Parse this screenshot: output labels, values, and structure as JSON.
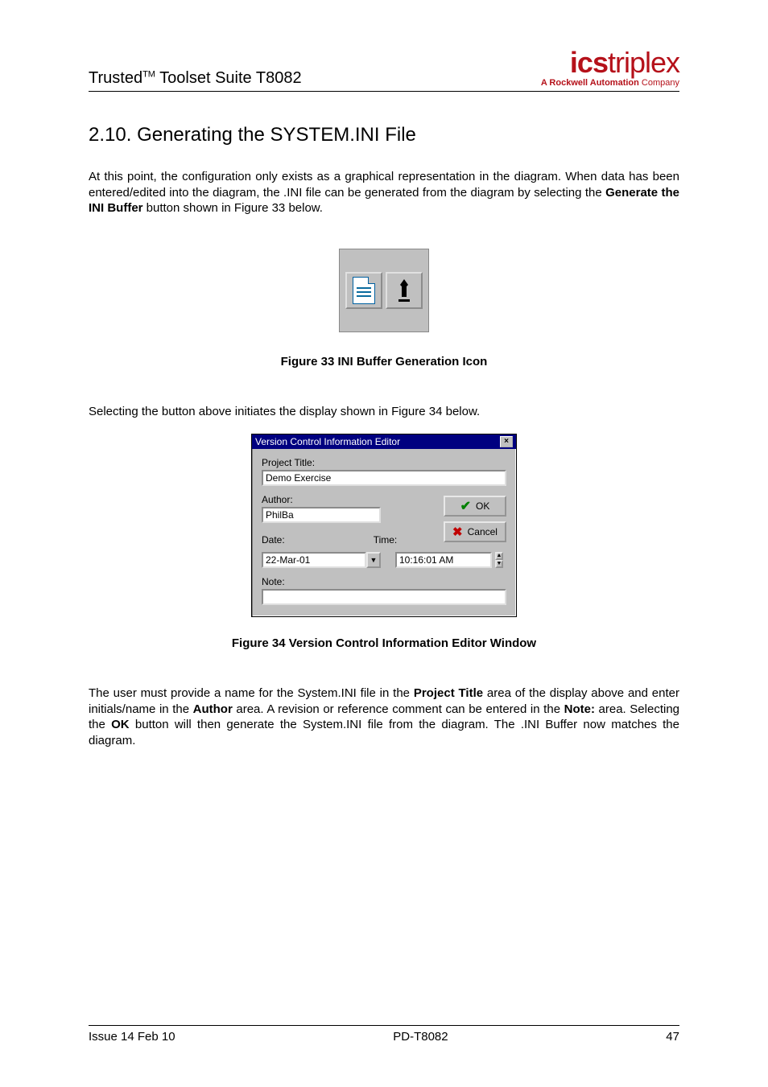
{
  "header": {
    "product_line": "Trusted",
    "tm": "TM",
    "product_suffix": " Toolset Suite T8082",
    "logo_bold": "ics",
    "logo_light": "triplex",
    "tagline_prefix": "A ",
    "tagline_bold": "Rockwell Automation",
    "tagline_suffix": " Company"
  },
  "section": {
    "number": "2.10.",
    "title": "Generating the SYSTEM.INI File"
  },
  "para1_a": "At this point, the configuration only exists as a graphical representation in the diagram. When data has been entered/edited into the diagram, the .INI file can be generated from the diagram by selecting the ",
  "para1_bold": "Generate the INI Buffer",
  "para1_b": " button shown in Figure 33 below.",
  "fig33_caption": "Figure 33 INI Buffer Generation Icon",
  "para2": "Selecting the button above initiates the display shown in Figure 34 below.",
  "dialog": {
    "title": "Version Control Information Editor",
    "labels": {
      "project_title": "Project Title:",
      "author": "Author:",
      "date": "Date:",
      "time": "Time:",
      "note": "Note:"
    },
    "values": {
      "project_title": "Demo Exercise",
      "author": "PhilBa",
      "date": "22-Mar-01",
      "time": "10:16:01 AM",
      "note": ""
    },
    "buttons": {
      "ok": "OK",
      "cancel": "Cancel"
    }
  },
  "fig34_caption": "Figure 34 Version Control Information Editor Window",
  "para3_a": "The user must provide a name for the System.INI file in the ",
  "para3_b1": "Project Title",
  "para3_c": " area of the display above and enter initials/name in the ",
  "para3_b2": "Author",
  "para3_d": " area.  A revision or reference comment can be entered in the ",
  "para3_b3": "Note:",
  "para3_e": " area.  Selecting the ",
  "para3_b4": "OK",
  "para3_f": " button will then generate the System.INI file from the diagram. The .INI Buffer now matches the diagram.",
  "footer": {
    "left": "Issue 14 Feb 10",
    "center": "PD-T8082",
    "right": "47"
  }
}
